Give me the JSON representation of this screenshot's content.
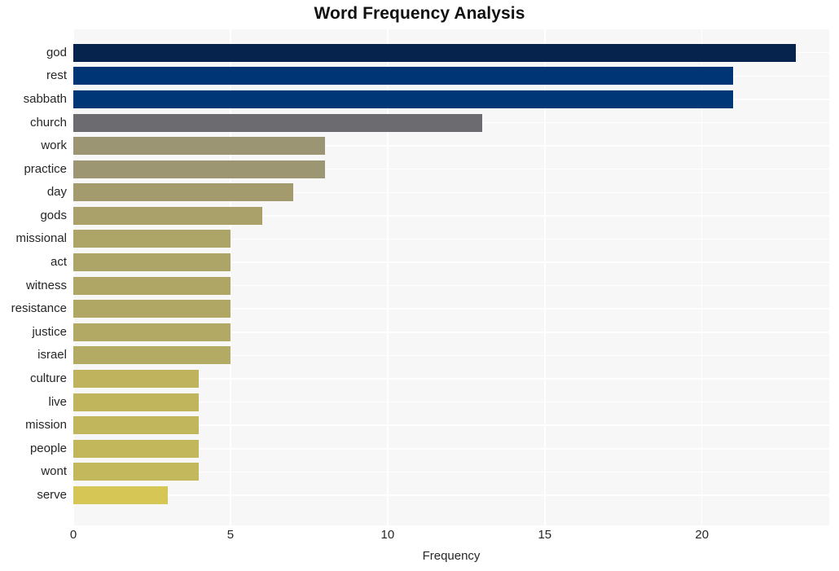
{
  "chart_data": {
    "type": "bar",
    "orientation": "horizontal",
    "title": "Word Frequency Analysis",
    "xlabel": "Frequency",
    "ylabel": "",
    "xlim": [
      0,
      24.05
    ],
    "xticks": [
      0,
      5,
      10,
      15,
      20
    ],
    "xtick_labels": [
      "0",
      "5",
      "10",
      "15",
      "20"
    ],
    "grid": true,
    "grid_color": "#ffffff",
    "plot_background": "#f7f7f7",
    "figure_background": "#ffffff",
    "legend": null,
    "categories": [
      "god",
      "rest",
      "sabbath",
      "church",
      "work",
      "practice",
      "day",
      "gods",
      "missional",
      "act",
      "witness",
      "resistance",
      "justice",
      "israel",
      "culture",
      "live",
      "mission",
      "people",
      "wont",
      "serve"
    ],
    "values": [
      23,
      21,
      21,
      13,
      8,
      8,
      7,
      6,
      5,
      5,
      5,
      5,
      5,
      5,
      4,
      4,
      4,
      4,
      4,
      3
    ],
    "bar_colors": [
      "#05234d",
      "#003575",
      "#003777",
      "#6b6b70",
      "#9b9573",
      "#9c9673",
      "#a39b6e",
      "#a9a06a",
      "#ada468",
      "#ada468",
      "#afa666",
      "#b0a765",
      "#b2a964",
      "#b3aa63",
      "#bfb45d",
      "#c0b55c",
      "#c1b65c",
      "#c2b75b",
      "#c3b85b",
      "#d6c655"
    ]
  },
  "axis": {
    "title": "Word Frequency Analysis",
    "xlabel": "Frequency"
  }
}
